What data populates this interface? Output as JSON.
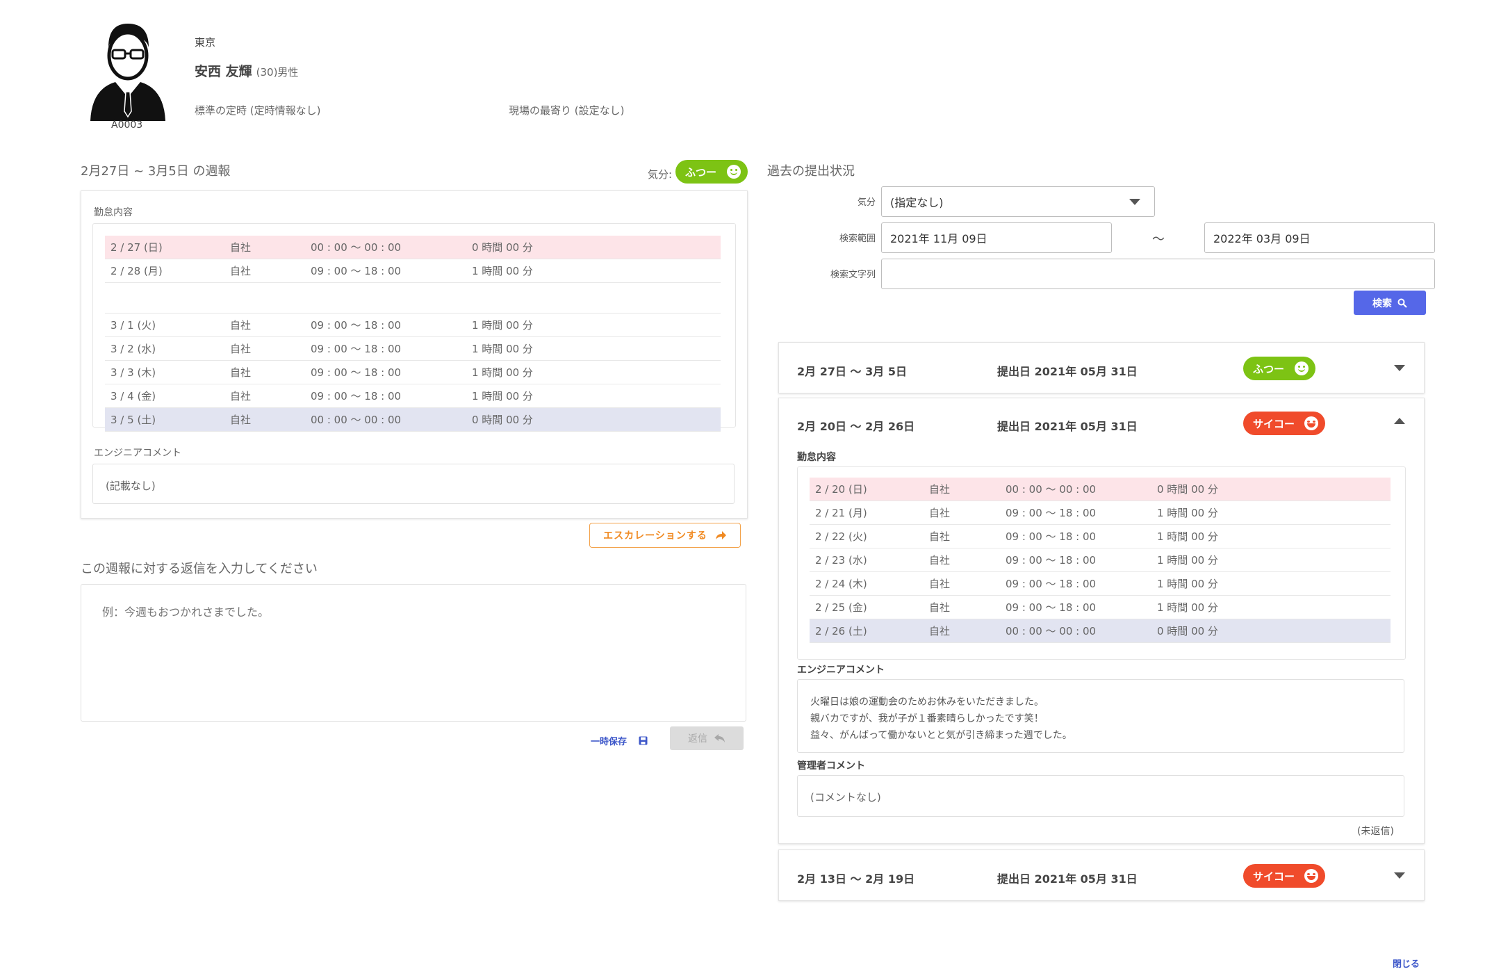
{
  "profile": {
    "employee_id": "A0003",
    "office": "東京",
    "name": "安西 友輝",
    "age_gender": "(30)男性",
    "standard_hours": "標準の定時 (定時情報なし)",
    "nearest_station": "現場の最寄り (設定なし)"
  },
  "weekly": {
    "title": "2月27日 ~ 3月5日 の週報",
    "mood_label": "気分:",
    "mood": "ふつー",
    "attendance_label": "勤怠内容",
    "rows": [
      {
        "date": "2 / 27 (日)",
        "place": "自社",
        "time": "00 : 00 〜 00 : 00",
        "hours": "0 時間 00 分"
      },
      {
        "date": "2 / 28 (月)",
        "place": "自社",
        "time": "09 : 00 〜 18 : 00",
        "hours": "1 時間 00 分"
      },
      {
        "date": "3 / 1 (火)",
        "place": "自社",
        "time": "09 : 00 〜 18 : 00",
        "hours": "1 時間 00 分"
      },
      {
        "date": "3 / 2 (水)",
        "place": "自社",
        "time": "09 : 00 〜 18 : 00",
        "hours": "1 時間 00 分"
      },
      {
        "date": "3 / 3 (木)",
        "place": "自社",
        "time": "09 : 00 〜 18 : 00",
        "hours": "1 時間 00 分"
      },
      {
        "date": "3 / 4 (金)",
        "place": "自社",
        "time": "09 : 00 〜 18 : 00",
        "hours": "1 時間 00 分"
      },
      {
        "date": "3 / 5 (土)",
        "place": "自社",
        "time": "00 : 00 〜 00 : 00",
        "hours": "0 時間 00 分"
      }
    ],
    "engineer_comment_label": "エンジニアコメント",
    "engineer_comment": "(記載なし)",
    "escalate_label": "エスカレーションする",
    "reply_prompt": "この週報に対する返信を入力してください",
    "reply_placeholder": "例：今週もおつかれさまでした。",
    "save_label": "一時保存",
    "reply_label": "返信"
  },
  "history": {
    "title": "過去の提出状況",
    "mood_filter_label": "気分",
    "mood_filter_value": "(指定なし)",
    "range_label": "検索範囲",
    "range_from": "2021年 11月 09日",
    "range_sep": "〜",
    "range_to": "2022年 03月 09日",
    "keyword_label": "検索文字列",
    "keyword_value": "",
    "search_label": "検索",
    "items": [
      {
        "period": "2月 27日 〜 3月 5日",
        "submitted": "提出日 2021年 05月 31日",
        "mood": "ふつー"
      },
      {
        "period": "2月 20日 〜 2月 26日",
        "submitted": "提出日 2021年 05月 31日",
        "mood": "サイコー"
      },
      {
        "period": "2月 13日 〜 2月 19日",
        "submitted": "提出日 2021年 05月 31日",
        "mood": "サイコー"
      }
    ],
    "expanded": {
      "attendance_label": "勤怠内容",
      "rows": [
        {
          "date": "2 / 20 (日)",
          "place": "自社",
          "time": "00 : 00 〜 00 : 00",
          "hours": "0 時間 00 分"
        },
        {
          "date": "2 / 21 (月)",
          "place": "自社",
          "time": "09 : 00 〜 18 : 00",
          "hours": "1 時間 00 分"
        },
        {
          "date": "2 / 22 (火)",
          "place": "自社",
          "time": "09 : 00 〜 18 : 00",
          "hours": "1 時間 00 分"
        },
        {
          "date": "2 / 23 (水)",
          "place": "自社",
          "time": "09 : 00 〜 18 : 00",
          "hours": "1 時間 00 分"
        },
        {
          "date": "2 / 24 (木)",
          "place": "自社",
          "time": "09 : 00 〜 18 : 00",
          "hours": "1 時間 00 分"
        },
        {
          "date": "2 / 25 (金)",
          "place": "自社",
          "time": "09 : 00 〜 18 : 00",
          "hours": "1 時間 00 分"
        },
        {
          "date": "2 / 26 (土)",
          "place": "自社",
          "time": "00 : 00 〜 00 : 00",
          "hours": "0 時間 00 分"
        }
      ],
      "engineer_comment_label": "エンジニアコメント",
      "engineer_comment_lines": [
        "火曜日は娘の運動会のためお休みをいただきました。",
        "親バカですが、我が子が１番素晴らしかったです笑！",
        "益々、がんばって働かないとと気が引き締まった週でした。"
      ],
      "manager_comment_label": "管理者コメント",
      "manager_comment": "(コメントなし)",
      "reply_status": "(未返信)"
    }
  },
  "close_label": "閉じる",
  "colors": {
    "mood_normal": "#7dc314",
    "mood_best": "#f04b2b",
    "primary": "#5567e8",
    "escalate": "#f08a22",
    "sunday_row": "#fde4e8",
    "saturday_row": "#e2e4f1"
  },
  "icons": {
    "avatar": "businessman-avatar-icon",
    "mood_normal": "smile-face-icon",
    "mood_best": "grin-face-icon",
    "escalate": "share-arrow-icon",
    "save": "floppy-disk-icon",
    "reply": "reply-arrow-icon",
    "search": "search-icon",
    "expand": "chevron-down-icon",
    "collapse": "chevron-up-icon"
  }
}
